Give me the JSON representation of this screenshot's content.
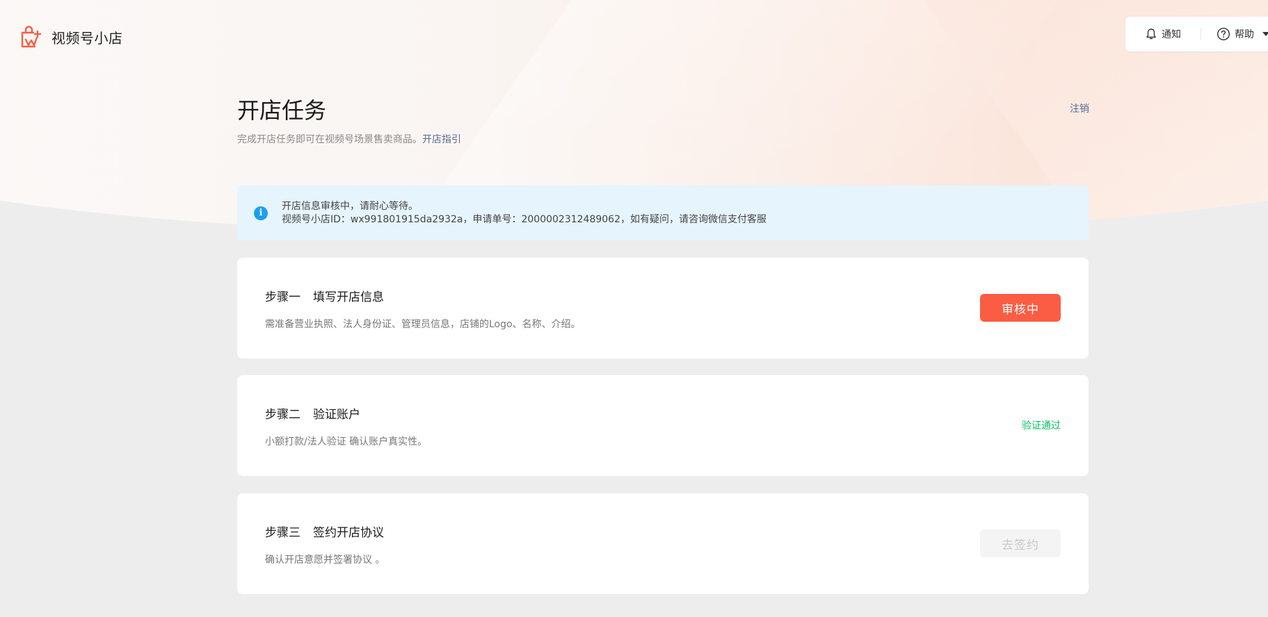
{
  "brand": {
    "name": "视频号小店",
    "accent_color": "#fa5d43"
  },
  "toolbar": {
    "notify_label": "通知",
    "help_label": "帮助"
  },
  "header": {
    "title": "开店任务",
    "subtitle": "完成开店任务即可在视频号场景售卖商品。",
    "guide_link": "开店指引",
    "logout_label": "注销"
  },
  "notice": {
    "line1": "开店信息审核中，请耐心等待。",
    "line2": "视频号小店ID：wx991801915da2932a，申请单号：2000002312489062，如有疑问，请咨询微信支付客服"
  },
  "steps": [
    {
      "number": "步骤一",
      "title": "填写开店信息",
      "desc": "需准备营业执照、法人身份证、管理员信息，店铺的Logo、名称、介绍。",
      "action_label": "审核中"
    },
    {
      "number": "步骤二",
      "title": "验证账户",
      "desc": "小额打款/法人验证 确认账户真实性。",
      "status_label": "验证通过",
      "status_color": "#07c160"
    },
    {
      "number": "步骤三",
      "title": "签约开店协议",
      "desc": "确认开店意愿并签署协议 。",
      "action_label": "去签约"
    }
  ]
}
